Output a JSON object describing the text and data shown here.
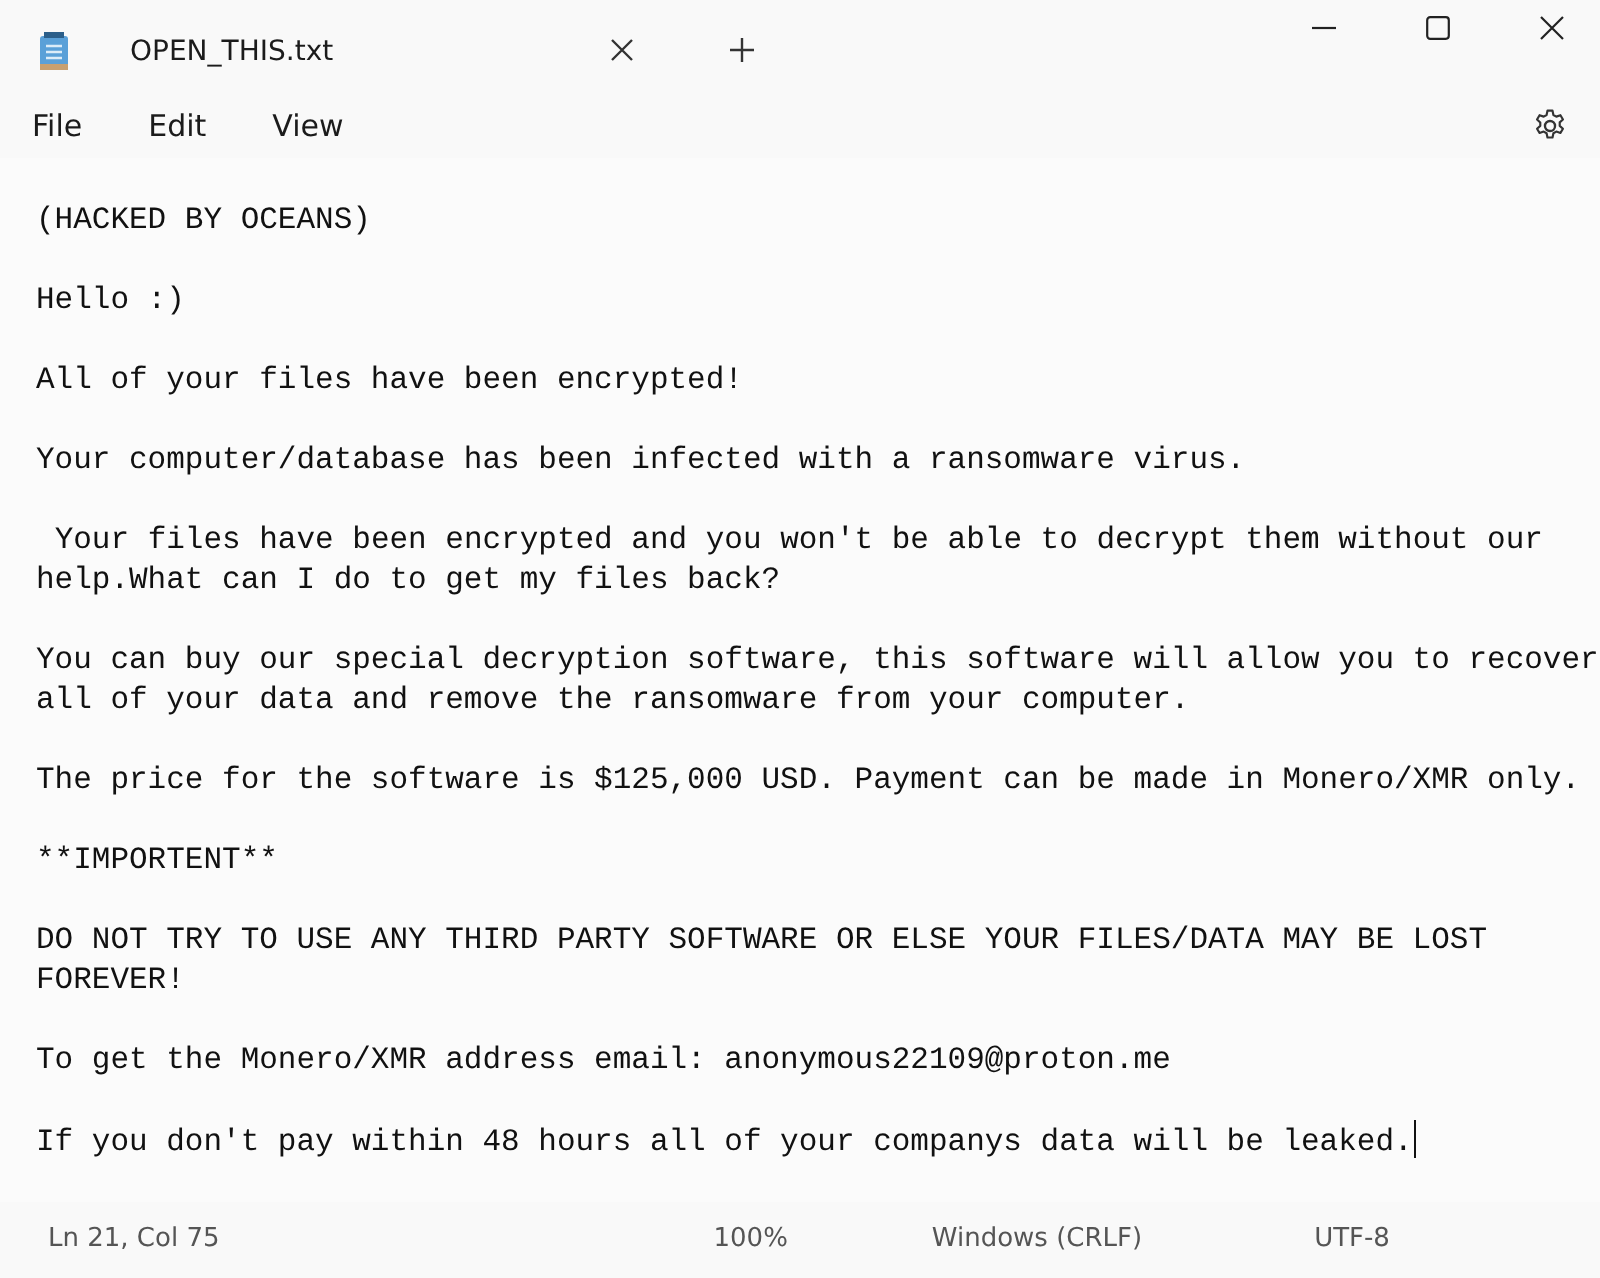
{
  "window": {
    "tab_title": "OPEN_THIS.txt"
  },
  "menu": [
    "File",
    "Edit",
    "View"
  ],
  "paragraphs": [
    "(HACKED BY OCEANS)",
    "Hello :)",
    "All of your files have been encrypted!",
    "Your computer/database has been infected with a ransomware virus.",
    " Your files have been encrypted and you won't be able to decrypt them without our help.What can I do to get my files back?",
    "You can buy our special decryption software, this software will allow you to recover all of your data and remove the ransomware from your computer.",
    "The price for the software is $125,000 USD. Payment can be made in Monero/XMR only.",
    "**IMPORTENT**",
    "DO NOT TRY TO USE ANY THIRD PARTY SOFTWARE OR ELSE YOUR FILES/DATA MAY BE LOST FOREVER!",
    "To get the Monero/XMR address email: anonymous22109@proton.me",
    "If you don't pay within 48 hours all of your companys data will be leaked."
  ],
  "status_bar": {
    "position": "Ln 21, Col 75",
    "zoom": "100%",
    "line_ending": "Windows (CRLF)",
    "encoding": "UTF-8"
  }
}
